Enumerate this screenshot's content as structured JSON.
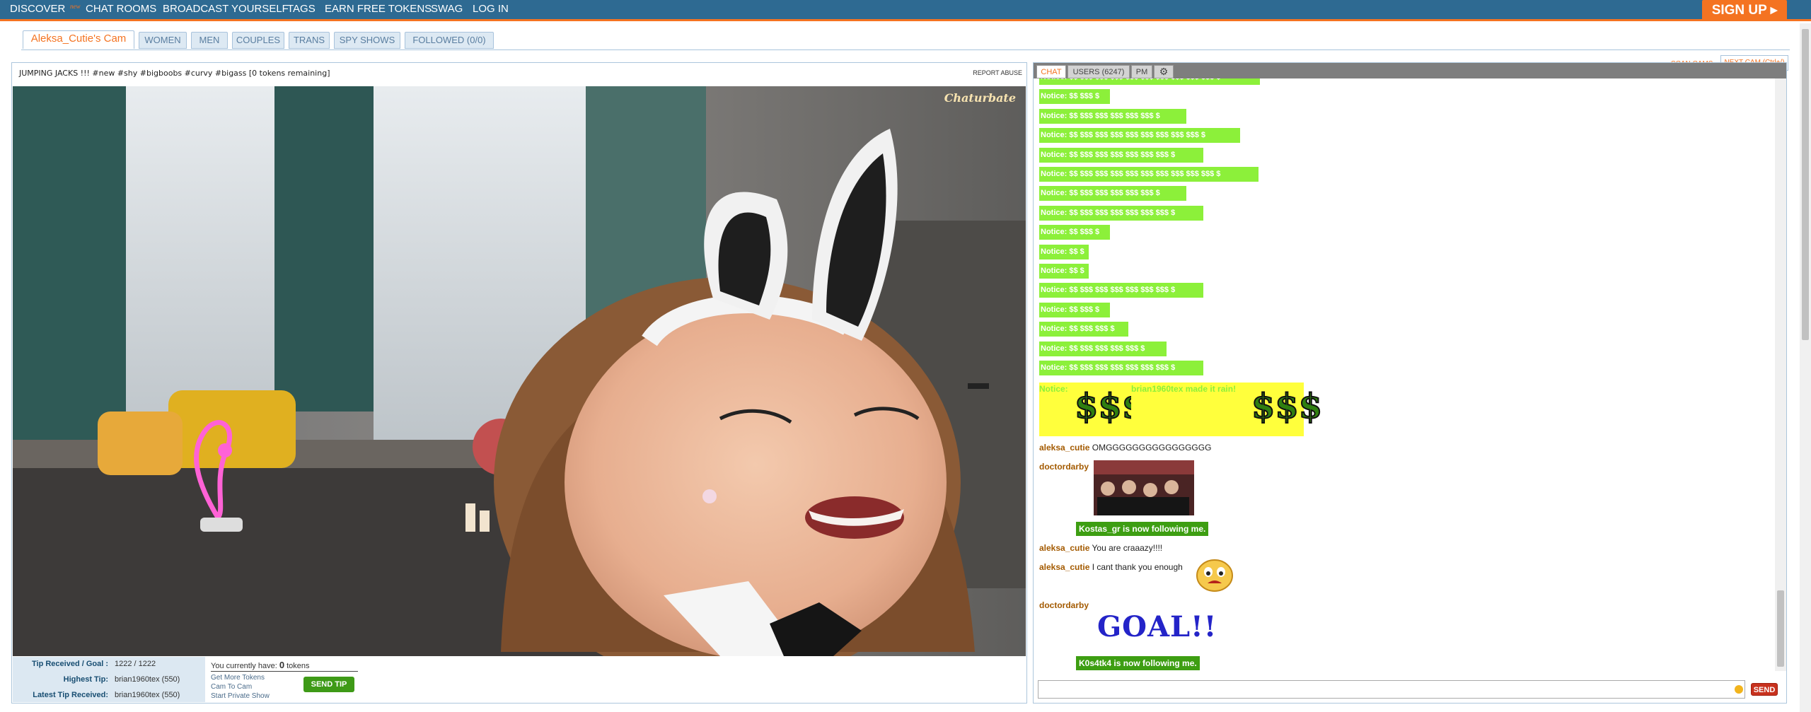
{
  "nav": {
    "discover": "DISCOVER",
    "discover_badge": "new",
    "chat_rooms": "CHAT ROOMS",
    "broadcast": "BROADCAST YOURSELF",
    "tags": "TAGS",
    "earn_tokens": "EARN FREE TOKENS",
    "swag": "SWAG",
    "login": "LOG IN",
    "signup": "SIGN UP ▸"
  },
  "tabs": {
    "room": "Aleksa_Cutie's Cam",
    "women": "WOMEN",
    "men": "MEN",
    "couples": "COUPLES",
    "trans": "TRANS",
    "spy": "SPY SHOWS",
    "followed": "FOLLOWED (0/0)",
    "scan_cams": "SCAN CAMS",
    "next_cam": "NEXT CAM (Ctrl+/)"
  },
  "room": {
    "subject": "JUMPING JACKS !!! #new #shy #bigboobs #curvy #bigass [0 tokens remaining]",
    "report_abuse": "REPORT ABUSE",
    "watermark": "Chaturbate"
  },
  "stats": {
    "tip_goal_label": "Tip Received / Goal :",
    "tip_goal_value": "1222 / 1222",
    "highest_tip_label": "Highest Tip:",
    "highest_tip_value": "brian1960tex (550)",
    "latest_tip_label": "Latest Tip Received:",
    "latest_tip_value": "brian1960tex (550)",
    "you_have_prefix": "You currently have:",
    "token_count": "0",
    "tokens_suffix": "tokens",
    "get_more_tokens": "Get More Tokens",
    "cam_to_cam": "Cam To Cam",
    "private_show": "Start Private Show",
    "send_tip": "SEND TIP"
  },
  "chat": {
    "tab_chat": "CHAT",
    "tab_users": "USERS (6247)",
    "tab_pm": "PM",
    "notices": [
      "Notice: $$ $$$ $$$ $$$ $$$ $$$ $$$ $$$ $$$ $$$ $",
      "Notice: $$ $$$ $",
      "Notice: $$ $$$ $$$ $$$ $$$ $$$ $",
      "Notice: $$ $$$ $$$ $$$ $$$ $$$ $$$ $$$ $$$ $",
      "Notice: $$ $$$ $$$ $$$ $$$ $$$ $$$ $",
      "Notice: $$ $$$ $$$ $$$ $$$ $$$ $$$ $$$ $$$ $$$ $",
      "Notice: $$ $$$ $$$ $$$ $$$ $$$ $",
      "Notice: $$ $$$ $$$ $$$ $$$ $$$ $$$ $",
      "Notice: $$ $$$ $",
      "Notice: $$ $",
      "Notice: $$ $",
      "Notice: $$ $$$ $$$ $$$ $$$ $$$ $$$ $",
      "Notice: $$ $$$ $",
      "Notice: $$ $$$ $$$ $",
      "Notice: $$ $$$ $$$ $$$ $$$ $",
      "Notice: $$ $$$ $$$ $$$ $$$ $$$ $$$ $"
    ],
    "rain_notice": "Notice:",
    "rain_symbol": "$$$",
    "rain_text": "brian1960tex made it rain!",
    "msg1_user": "aleksa_cutie",
    "msg1_text": "OMGGGGGGGGGGGGGGGG",
    "msg2_user": "doctordarby",
    "follow1": "Kostas_gr is now following me.",
    "msg3_user": "aleksa_cutie",
    "msg3_text": "You are craaazy!!!!",
    "msg4_user": "aleksa_cutie",
    "msg4_text": "I cant thank you enough",
    "msg5_user": "doctordarby",
    "goal_text": "GOAL!!",
    "follow2": "K0s4tk4 is now following me.",
    "send": "SEND"
  }
}
